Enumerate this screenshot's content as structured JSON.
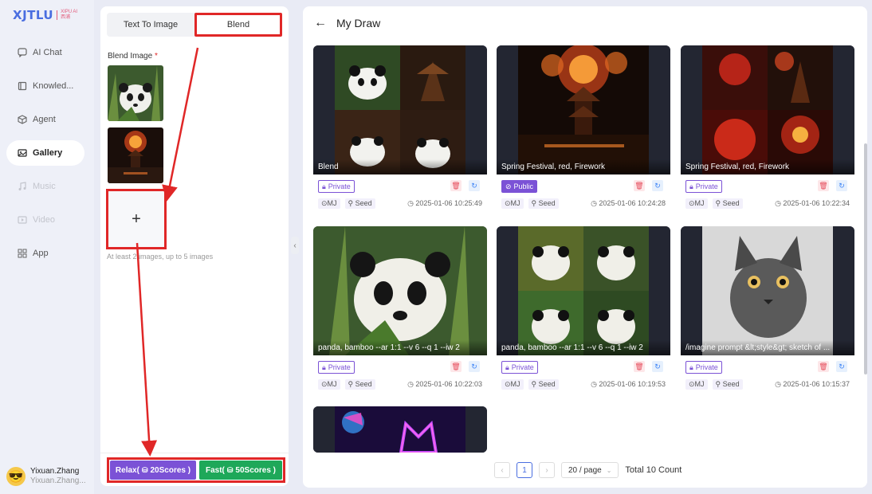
{
  "brand": {
    "name": "XJTLU",
    "sub1": "XIPU AI",
    "sub2": "西浦"
  },
  "nav": [
    {
      "label": "AI Chat",
      "icon": "chat-icon",
      "state": "normal"
    },
    {
      "label": "Knowled...",
      "icon": "book-icon",
      "state": "normal"
    },
    {
      "label": "Agent",
      "icon": "cube-icon",
      "state": "normal"
    },
    {
      "label": "Gallery",
      "icon": "gallery-icon",
      "state": "active"
    },
    {
      "label": "Music",
      "icon": "music-icon",
      "state": "disabled"
    },
    {
      "label": "Video",
      "icon": "video-icon",
      "state": "disabled"
    },
    {
      "label": "App",
      "icon": "grid-icon",
      "state": "normal"
    }
  ],
  "user": {
    "name": "Yixuan.Zhang",
    "handle": "Yixuan.Zhang..."
  },
  "panel": {
    "tab_text_to_image": "Text To Image",
    "tab_blend": "Blend",
    "blend_label": "Blend Image",
    "required_mark": "*",
    "add_symbol": "+",
    "hint": "At least 2 images, up to 5 images",
    "relax_label": "Relax(",
    "relax_scores": "20Scores )",
    "fast_label": "Fast(",
    "fast_scores": "50Scores )"
  },
  "main": {
    "title": "My Draw",
    "cards": [
      {
        "caption": "Blend",
        "visibility": "Private",
        "model": "MJ",
        "seed": "Seed",
        "date": "2025-01-06 10:25:49"
      },
      {
        "caption": "Spring Festival, red, Firework",
        "visibility": "Public",
        "model": "MJ",
        "seed": "Seed",
        "date": "2025-01-06 10:24:28"
      },
      {
        "caption": "Spring Festival, red, Firework",
        "visibility": "Private",
        "model": "MJ",
        "seed": "Seed",
        "date": "2025-01-06 10:22:34"
      },
      {
        "caption": "panda, bamboo --ar 1:1 --v 6 --q 1 --iw 2",
        "visibility": "Private",
        "model": "MJ",
        "seed": "Seed",
        "date": "2025-01-06 10:22:03"
      },
      {
        "caption": "panda, bamboo --ar 1:1 --v 6 --q 1 --iw 2",
        "visibility": "Private",
        "model": "MJ",
        "seed": "Seed",
        "date": "2025-01-06 10:19:53"
      },
      {
        "caption": "/imagine prompt &lt;style&gt; sketch of ...",
        "visibility": "Private",
        "model": "MJ",
        "seed": "Seed",
        "date": "2025-01-06 10:15:37"
      }
    ]
  },
  "pagination": {
    "current_page": "1",
    "page_size": "20 / page",
    "total": "Total 10 Count"
  }
}
